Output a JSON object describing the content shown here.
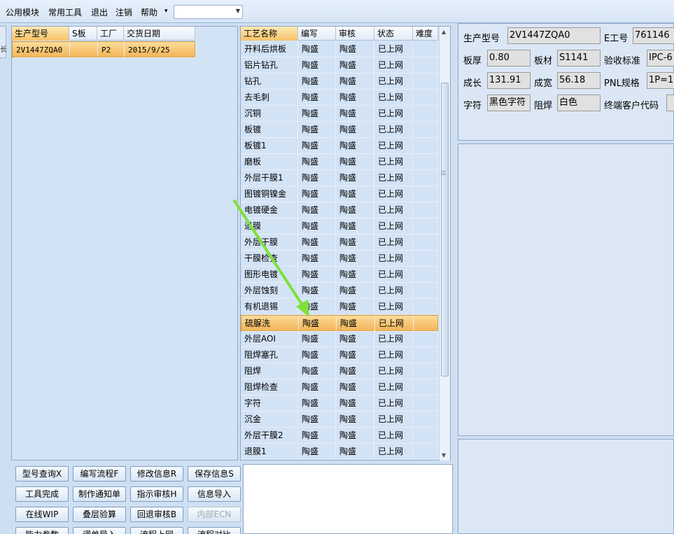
{
  "menu": {
    "items": [
      "公用模块",
      "常用工具",
      "退出",
      "注销",
      "帮助"
    ],
    "help_dropdown": "▾",
    "combo_value": ""
  },
  "left_edge_glyph": "长",
  "order_grid": {
    "headers": [
      "生产型号",
      "S板",
      "工厂",
      "交货日期"
    ],
    "rows": [
      {
        "model": "2V1447ZQA0",
        "s": "",
        "factory": "P2",
        "date": "2015/9/25"
      }
    ]
  },
  "process_grid": {
    "headers": [
      "工艺名称",
      "编写",
      "审核",
      "状态",
      "难度"
    ],
    "rows": [
      {
        "name": "开料后烘板",
        "writer": "陶盛",
        "reviewer": "陶盛",
        "status": "已上网",
        "difficulty": ""
      },
      {
        "name": "铝片钻孔",
        "writer": "陶盛",
        "reviewer": "陶盛",
        "status": "已上网",
        "difficulty": ""
      },
      {
        "name": "钻孔",
        "writer": "陶盛",
        "reviewer": "陶盛",
        "status": "已上网",
        "difficulty": ""
      },
      {
        "name": "去毛刺",
        "writer": "陶盛",
        "reviewer": "陶盛",
        "status": "已上网",
        "difficulty": ""
      },
      {
        "name": "沉铜",
        "writer": "陶盛",
        "reviewer": "陶盛",
        "status": "已上网",
        "difficulty": ""
      },
      {
        "name": "板镀",
        "writer": "陶盛",
        "reviewer": "陶盛",
        "status": "已上网",
        "difficulty": ""
      },
      {
        "name": "板镀1",
        "writer": "陶盛",
        "reviewer": "陶盛",
        "status": "已上网",
        "difficulty": ""
      },
      {
        "name": "磨板",
        "writer": "陶盛",
        "reviewer": "陶盛",
        "status": "已上网",
        "difficulty": ""
      },
      {
        "name": "外层干膜1",
        "writer": "陶盛",
        "reviewer": "陶盛",
        "status": "已上网",
        "difficulty": ""
      },
      {
        "name": "图镀铜镍金",
        "writer": "陶盛",
        "reviewer": "陶盛",
        "status": "已上网",
        "difficulty": ""
      },
      {
        "name": "电镀硬金",
        "writer": "陶盛",
        "reviewer": "陶盛",
        "status": "已上网",
        "difficulty": ""
      },
      {
        "name": "退膜",
        "writer": "陶盛",
        "reviewer": "陶盛",
        "status": "已上网",
        "difficulty": ""
      },
      {
        "name": "外层干膜",
        "writer": "陶盛",
        "reviewer": "陶盛",
        "status": "已上网",
        "difficulty": ""
      },
      {
        "name": "干膜检查",
        "writer": "陶盛",
        "reviewer": "陶盛",
        "status": "已上网",
        "difficulty": ""
      },
      {
        "name": "图形电镀",
        "writer": "陶盛",
        "reviewer": "陶盛",
        "status": "已上网",
        "difficulty": ""
      },
      {
        "name": "外层蚀刻",
        "writer": "陶盛",
        "reviewer": "陶盛",
        "status": "已上网",
        "difficulty": ""
      },
      {
        "name": "有机退锡",
        "writer": "陶盛",
        "reviewer": "陶盛",
        "status": "已上网",
        "difficulty": ""
      },
      {
        "name": "硫脲洗",
        "writer": "陶盛",
        "reviewer": "陶盛",
        "status": "已上网",
        "difficulty": ""
      },
      {
        "name": "外层AOI",
        "writer": "陶盛",
        "reviewer": "陶盛",
        "status": "已上网",
        "difficulty": ""
      },
      {
        "name": "阻焊塞孔",
        "writer": "陶盛",
        "reviewer": "陶盛",
        "status": "已上网",
        "difficulty": ""
      },
      {
        "name": "阻焊",
        "writer": "陶盛",
        "reviewer": "陶盛",
        "status": "已上网",
        "difficulty": ""
      },
      {
        "name": "阻焊检查",
        "writer": "陶盛",
        "reviewer": "陶盛",
        "status": "已上网",
        "difficulty": ""
      },
      {
        "name": "字符",
        "writer": "陶盛",
        "reviewer": "陶盛",
        "status": "已上网",
        "difficulty": ""
      },
      {
        "name": "沉金",
        "writer": "陶盛",
        "reviewer": "陶盛",
        "status": "已上网",
        "difficulty": ""
      },
      {
        "name": "外层干膜2",
        "writer": "陶盛",
        "reviewer": "陶盛",
        "status": "已上网",
        "difficulty": ""
      },
      {
        "name": "退膜1",
        "writer": "陶盛",
        "reviewer": "陶盛",
        "status": "已上网",
        "difficulty": ""
      }
    ],
    "selected_index": 17
  },
  "buttons": {
    "row1": [
      "型号查询X",
      "编写流程F",
      "修改信息R",
      "保存信息S"
    ],
    "row2": [
      "工具完成",
      "制作通知单",
      "指示审核H",
      "信息导入"
    ],
    "row3": [
      "在线WIP",
      "叠层验算",
      "回退审核B",
      "内部ECN"
    ],
    "row4": [
      "能力参数",
      "调单导入",
      "流程上网",
      "流程对比"
    ]
  },
  "info": {
    "labels": {
      "model": "生产型号",
      "e_no": "E工号",
      "thickness": "板厚",
      "material": "板材",
      "standard": "验收标准",
      "length": "成长",
      "width": "成宽",
      "pnl": "PNL规格",
      "legend": "字符",
      "mask": "阻焊",
      "customer": "终端客户代码"
    },
    "values": {
      "model": "2V1447ZQA0",
      "e_no": "761146",
      "thickness": "0.80",
      "material": "S1141",
      "standard": "IPC-6",
      "length": "131.91",
      "width": "56.18",
      "pnl": "1P=1",
      "legend": "黑色字符",
      "mask": "白色",
      "customer": ""
    }
  },
  "annotation": {
    "arrow_color": "#7ee03a"
  },
  "colors": {
    "selected_row": "#f7c36a",
    "panel_bg": "#d3e3f6",
    "menubar": "#dce8f6"
  }
}
